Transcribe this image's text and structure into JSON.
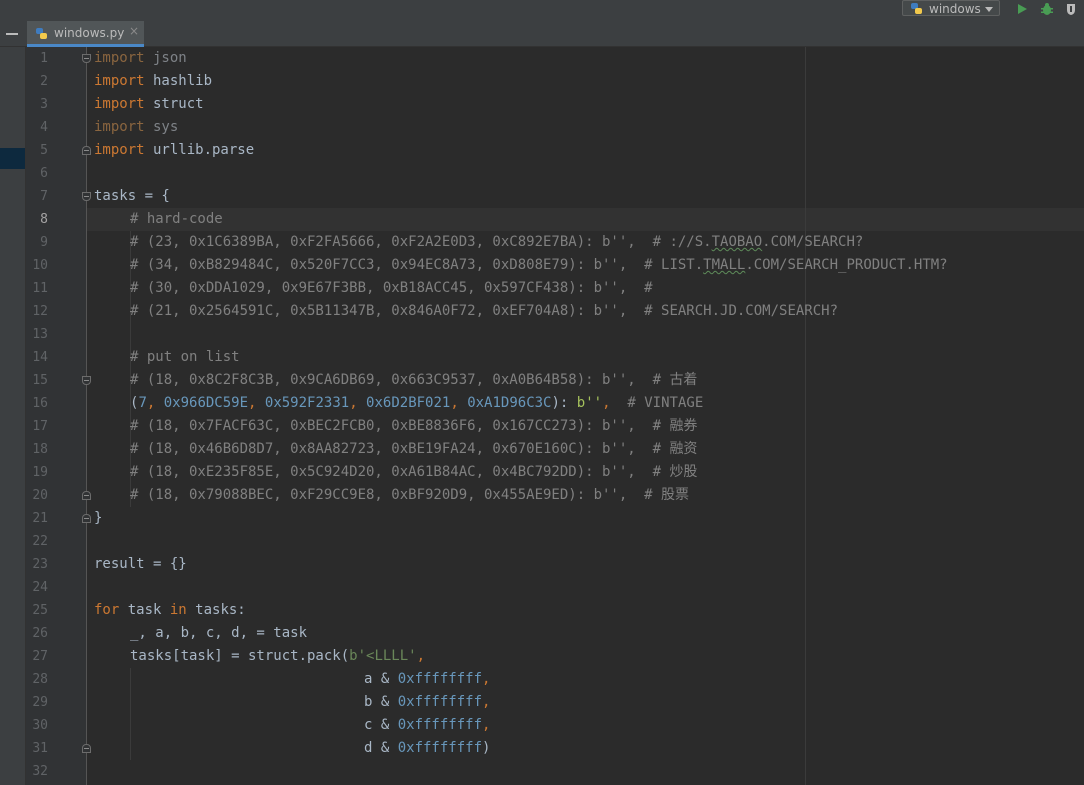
{
  "toolbar": {
    "run_config": "windows",
    "icons": [
      "python-icon",
      "run-icon",
      "debug-icon",
      "coverage-icon"
    ],
    "colors": {
      "run": "#499c54",
      "debug": "#499c54"
    }
  },
  "tab": {
    "filename": "windows.py",
    "close": "×"
  },
  "gutter": {
    "line_numbers": [
      "1",
      "2",
      "3",
      "4",
      "5",
      "6",
      "7",
      "8",
      "9",
      "10",
      "11",
      "12",
      "13",
      "14",
      "15",
      "16",
      "17",
      "18",
      "19",
      "20",
      "21",
      "22",
      "23",
      "24",
      "25",
      "26",
      "27",
      "28",
      "29",
      "30",
      "31",
      "32"
    ],
    "current_line": "8"
  },
  "code": {
    "l1": {
      "kw": "import",
      "rest": " json"
    },
    "l2": {
      "kw": "import",
      "rest": " hashlib"
    },
    "l3": {
      "kw": "import",
      "rest": " struct"
    },
    "l4": {
      "kw": "import",
      "rest": " sys"
    },
    "l5": {
      "kw": "import",
      "rest": " urllib.parse"
    },
    "l7": {
      "text": "tasks = {"
    },
    "l8": {
      "comment": "# hard-code"
    },
    "l9": {
      "pre": "# (23, 0x1C6389BA, 0xF2FA5666, 0xF2A2E0D3, 0xC892E7BA): b'',  # ://S.",
      "sq": "TAOBAO",
      "post": ".COM/SEARCH?"
    },
    "l10": {
      "pre": "# (34, 0xB829484C, 0x520F7CC3, 0x94EC8A73, 0xD808E79): b'',  # LIST.",
      "sq": "TMALL",
      "post": ".COM/SEARCH_PRODUCT.HTM?"
    },
    "l11": {
      "comment": "# (30, 0xDDA1029, 0x9E67F3BB, 0xB18ACC45, 0x597CF438): b'',  #"
    },
    "l12": {
      "comment": "# (21, 0x2564591C, 0x5B11347B, 0x846A0F72, 0xEF704A8): b'',  # SEARCH.JD.COM/SEARCH?"
    },
    "l14": {
      "comment": "# put on list"
    },
    "l15": {
      "comment": "# (18, 0x8C2F8C3B, 0x9CA6DB69, 0x663C9537, 0xA0B64B58): b'',  # 古着"
    },
    "l16": {
      "open": "(",
      "n0": "7",
      "c1": ", ",
      "n1": "0x966DC59E",
      "c2": ", ",
      "n2": "0x592F2331",
      "c3": ", ",
      "n3": "0x6D2BF021",
      "c4": ", ",
      "n4": "0xA1D96C3C",
      "c5": "): ",
      "b": "b''",
      "c6": ",  ",
      "cm": "# VINTAGE"
    },
    "l17": {
      "comment": "# (18, 0x7FACF63C, 0xBEC2FCB0, 0xBE8836F6, 0x167CC273): b'',  # 融券"
    },
    "l18": {
      "comment": "# (18, 0x46B6D8D7, 0x8AA82723, 0xBE19FA24, 0x670E160C): b'',  # 融资"
    },
    "l19": {
      "comment": "# (18, 0xE235F85E, 0x5C924D20, 0xA61B84AC, 0x4BC792DD): b'',  # 炒股"
    },
    "l20": {
      "comment": "# (18, 0x79088BEC, 0xF29CC9E8, 0xBF920D9, 0x455AE9ED): b'',  # 股票"
    },
    "l21": {
      "text": "}"
    },
    "l23": {
      "text": "result = {}"
    },
    "l25": {
      "kw1": "for",
      "mid1": " task ",
      "kw2": "in",
      "mid2": " tasks:"
    },
    "l26": {
      "text": "_, a, b, c, d, = task"
    },
    "l27": {
      "pre": "tasks[task] = struct.pack(",
      "str": "b'<LLLL'",
      "post": ","
    },
    "l28": {
      "var": "a & ",
      "num": "0xffffffff",
      "end": ","
    },
    "l29": {
      "var": "b & ",
      "num": "0xffffffff",
      "end": ","
    },
    "l30": {
      "var": "c & ",
      "num": "0xffffffff",
      "end": ","
    },
    "l31": {
      "var": "d & ",
      "num": "0xffffffff",
      "end": ")"
    }
  }
}
